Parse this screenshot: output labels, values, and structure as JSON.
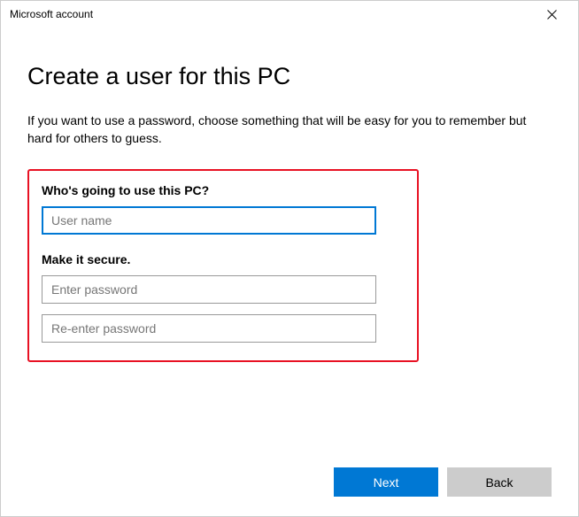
{
  "titlebar": {
    "title": "Microsoft account"
  },
  "content": {
    "heading": "Create a user for this PC",
    "subtext": "If you want to use a password, choose something that will be easy for you to remember but hard for others to guess.",
    "section1_label": "Who's going to use this PC?",
    "username_placeholder": "User name",
    "username_value": "",
    "section2_label": "Make it secure.",
    "password_placeholder": "Enter password",
    "password_value": "",
    "confirm_placeholder": "Re-enter password",
    "confirm_value": ""
  },
  "footer": {
    "next_label": "Next",
    "back_label": "Back"
  }
}
